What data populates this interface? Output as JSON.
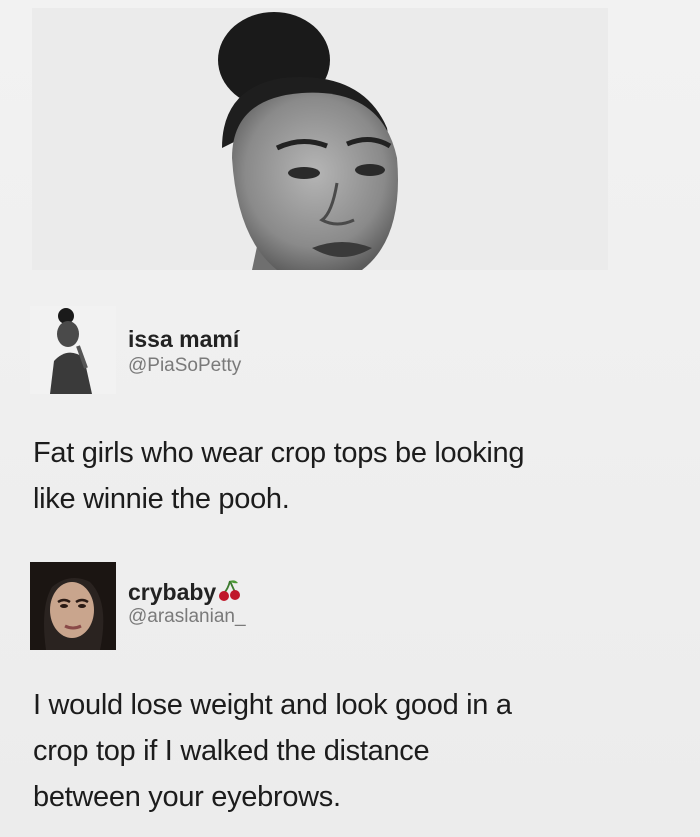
{
  "tweets": [
    {
      "display_name": "issa mamí",
      "handle": "@PiaSoPetty",
      "text_lines": [
        "Fat girls who wear crop tops be looking",
        "like winnie the pooh."
      ]
    },
    {
      "display_name": "crybaby",
      "handle": "@araslanian_",
      "badge_icon": "cherry-emoji",
      "text_lines": [
        "I would lose weight and look good in a",
        "crop top if I walked the distance",
        "between your eyebrows."
      ]
    }
  ],
  "colors": {
    "background": "#efefef",
    "text": "#1c1c1c",
    "handle": "#7a7a7a",
    "cherry": "#c0182a"
  }
}
